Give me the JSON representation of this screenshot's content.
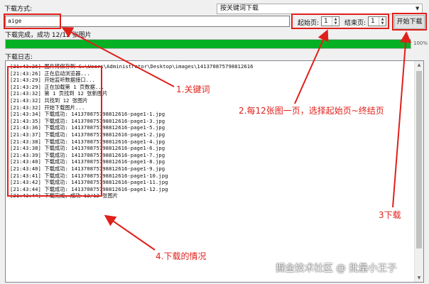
{
  "top": {
    "download_mode_label": "下载方式:",
    "mode_select_value": "按关键词下载"
  },
  "search": {
    "keyword_value": "aige",
    "start_page_label": "起始页:",
    "start_page_value": "1",
    "end_page_label": "结束页:",
    "end_page_value": "1",
    "start_button_label": "开始下载"
  },
  "status": {
    "text": "下载完成，成功 12/12 张图片",
    "progress_percent": 100,
    "progress_label": "100%"
  },
  "log": {
    "header": "下载日志:",
    "lines": [
      "[21:43:26] 图片将保存到 C:\\Users\\Administrator\\Desktop\\images\\141370875798812616",
      "[21:43:26] 正在启动浏览器...",
      "[21:43:29] 开始监听数据接口...",
      "[21:43:29] 正在加载第 1 页数据...",
      "[21:43:32] 第 1 页找到 12 张新图片",
      "[21:43:32] 共找到 12 张图片",
      "[21:43:32] 开始下载图片...",
      "[21:43:34] 下载成功: 141370875798812616-page1-1.jpg",
      "[21:43:35] 下载成功: 141370875798812616-page1-3.jpg",
      "[21:43:36] 下载成功: 141370875798812616-page1-5.jpg",
      "[21:43:37] 下载成功: 141370875798812616-page1-2.jpg",
      "[21:43:38] 下载成功: 141370875798812616-page1-4.jpg",
      "[21:43:38] 下载成功: 141370875798812616-page1-6.jpg",
      "[21:43:39] 下载成功: 141370875798812616-page1-7.jpg",
      "[21:43:40] 下载成功: 141370875798812616-page1-8.jpg",
      "[21:43:40] 下载成功: 141370875798812616-page1-9.jpg",
      "[21:43:41] 下载成功: 141370875798812616-page1-10.jpg",
      "[21:43:42] 下载成功: 141370875798812616-page1-11.jpg",
      "[21:43:44] 下载成功: 141370875798812616-page1-12.jpg",
      "[21:43:44] 下载完成，成功 12/12 张图片"
    ]
  },
  "annotations": {
    "keyword": "1.关键词",
    "pages": "2.每12张图一页，选择起始页~终结页",
    "download": "3下载",
    "log": "4.下载的情况"
  },
  "watermark": "掘金技术社区 @ 批量小王子",
  "colors": {
    "annotation_red": "#e0201b",
    "progress_green": "#06b025"
  }
}
